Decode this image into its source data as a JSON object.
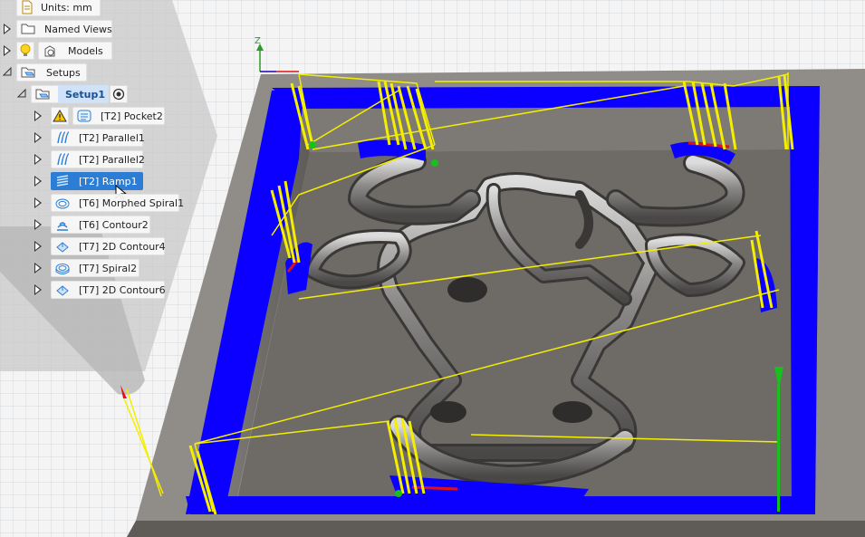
{
  "browser": {
    "units": "Units: mm",
    "named_views": "Named Views",
    "models": "Models",
    "setups": "Setups",
    "setup1": "Setup1",
    "operations": [
      {
        "label": "[T2] Pocket2",
        "icon": "pocket-icon",
        "warning": true
      },
      {
        "label": "[T2] Parallel1",
        "icon": "parallel-icon"
      },
      {
        "label": "[T2] Parallel2",
        "icon": "parallel-icon"
      },
      {
        "label": "[T2] Ramp1",
        "icon": "ramp-icon",
        "selected": true
      },
      {
        "label": "[T6] Morphed Spiral1",
        "icon": "morphed-spiral-icon"
      },
      {
        "label": "[T6] Contour2",
        "icon": "contour-icon"
      },
      {
        "label": "[T7] 2D Contour4",
        "icon": "2d-contour-icon"
      },
      {
        "label": "[T7] Spiral2",
        "icon": "spiral-icon"
      },
      {
        "label": "[T7] 2D Contour6",
        "icon": "2d-contour-icon"
      }
    ]
  },
  "viewcube": {
    "z_axis_label": "Z"
  },
  "colors": {
    "toolpath_blue": "#0b00ff",
    "rapid_yellow": "#f4ee00",
    "plunge_red": "#e0101a",
    "lead_green": "#19c01c",
    "stock_gray": "#6e6a66",
    "selection_blue": "#2c7dd6"
  }
}
